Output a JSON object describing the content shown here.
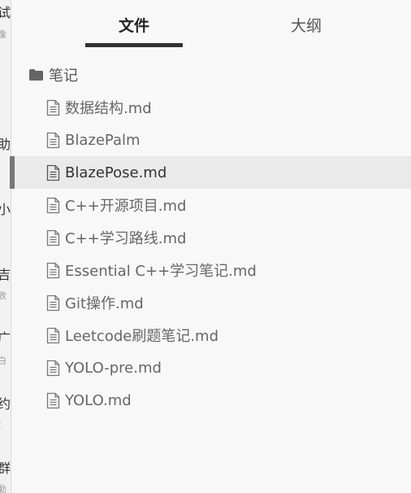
{
  "background_window": {
    "fragments": [
      "试",
      "像",
      "助",
      "小",
      "吉",
      "收",
      "广",
      "白",
      "约",
      "：",
      "群",
      "勤"
    ]
  },
  "tabs": {
    "files_label": "文件",
    "outline_label": "大纲"
  },
  "tree": {
    "folder": {
      "label": "笔记",
      "icon": "folder-icon"
    },
    "files": [
      {
        "label": "数据结构.md",
        "icon": "file-icon"
      },
      {
        "label": "BlazePalm",
        "icon": "file-icon"
      },
      {
        "label": "BlazePose.md",
        "icon": "file-icon",
        "active": true
      },
      {
        "label": "C++开源项目.md",
        "icon": "file-icon"
      },
      {
        "label": "C++学习路线.md",
        "icon": "file-icon"
      },
      {
        "label": "Essential C++学习笔记.md",
        "icon": "file-icon"
      },
      {
        "label": "Git操作.md",
        "icon": "file-icon"
      },
      {
        "label": "Leetcode刷题笔记.md",
        "icon": "file-icon"
      },
      {
        "label": "YOLO-pre.md",
        "icon": "file-icon"
      },
      {
        "label": "YOLO.md",
        "icon": "file-icon"
      }
    ]
  },
  "colors": {
    "active_row": "#eaeaea",
    "active_marker": "#777777",
    "tab_underline": "#333333"
  }
}
